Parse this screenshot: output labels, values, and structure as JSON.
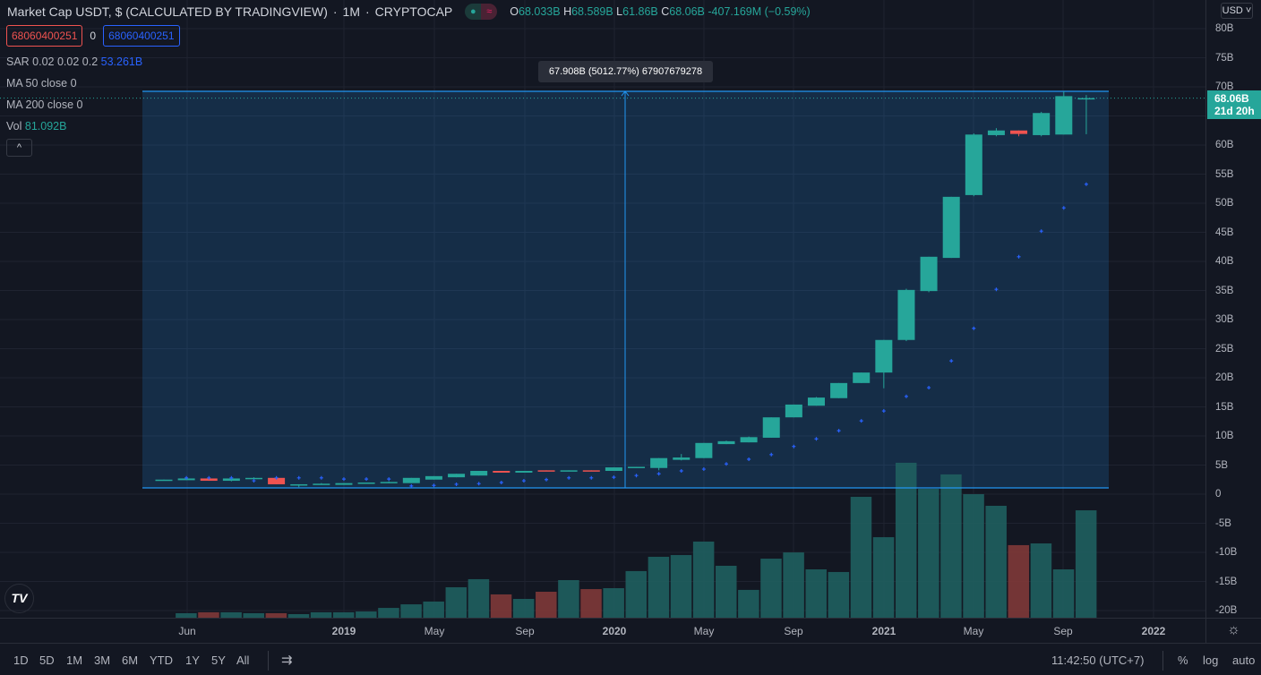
{
  "header": {
    "title": "Market Cap USDT, $ (CALCULATED BY TRADINGVIEW)",
    "interval": "1M",
    "exchange": "CRYPTOCAP",
    "ohlc": {
      "o_label": "O",
      "o": "68.033B",
      "h_label": "H",
      "h": "68.589B",
      "l_label": "L",
      "l": "61.86B",
      "c_label": "C",
      "c": "68.06B",
      "change": "-407.169M (−0.59%)"
    }
  },
  "order_boxes": {
    "sell": "68060400251",
    "qty": "0",
    "buy": "68060400251"
  },
  "indicators": {
    "sar": {
      "label": "SAR 0.02 0.02 0.2",
      "value": "53.261B"
    },
    "ma50": "MA 50 close 0",
    "ma200": "MA 200 close 0",
    "vol": {
      "label": "Vol",
      "value": "81.092B"
    }
  },
  "collapse_label": "^",
  "measure_tooltip": "67.908B (5012.77%) 67907679278",
  "price_axis": {
    "currency": "USD ˅",
    "current_price": "68.06B",
    "countdown": "21d 20h"
  },
  "colors": {
    "up": "#26a69a",
    "down": "#ef5350",
    "vol_up": "#1f5f5f",
    "vol_down": "#803838",
    "sar": "#2962ff",
    "measure": "#2196f3"
  },
  "time_axis": [
    "Jun",
    "2019",
    "May",
    "Sep",
    "2020",
    "May",
    "Sep",
    "2021",
    "May",
    "Sep",
    "2022"
  ],
  "toolbar": {
    "ranges": [
      "1D",
      "5D",
      "1M",
      "3M",
      "6M",
      "YTD",
      "1Y",
      "5Y",
      "All"
    ],
    "time": "11:42:50 (UTC+7)",
    "percent": "%",
    "log": "log",
    "auto": "auto"
  },
  "logo_text": "TV",
  "chart_data": {
    "type": "candlestick",
    "unit": "B USD",
    "start_month": "2018-05",
    "price_ticks": [
      80,
      75,
      70,
      65,
      60,
      55,
      50,
      45,
      40,
      35,
      30,
      25,
      20,
      15,
      10,
      5,
      0,
      -5,
      -10,
      -15,
      -20
    ],
    "ohlc": [
      [
        2.4,
        2.5,
        2.4,
        2.5
      ],
      [
        2.4,
        2.8,
        2.4,
        2.7
      ],
      [
        2.7,
        2.8,
        2.3,
        2.3
      ],
      [
        2.3,
        2.9,
        2.2,
        2.7
      ],
      [
        2.7,
        2.9,
        2.7,
        2.8
      ],
      [
        2.8,
        3.0,
        1.7,
        1.7
      ],
      [
        1.7,
        1.7,
        1.2,
        1.7
      ],
      [
        1.7,
        1.9,
        1.7,
        1.8
      ],
      [
        1.6,
        1.9,
        1.6,
        1.9
      ],
      [
        1.9,
        2.0,
        1.9,
        2.0
      ],
      [
        2.0,
        2.2,
        2.0,
        2.1
      ],
      [
        1.9,
        2.8,
        1.9,
        2.8
      ],
      [
        2.5,
        3.1,
        2.5,
        3.1
      ],
      [
        2.9,
        3.5,
        2.9,
        3.5
      ],
      [
        3.2,
        4.0,
        3.2,
        4.0
      ],
      [
        4.0,
        4.0,
        3.7,
        3.7
      ],
      [
        3.7,
        4.0,
        3.7,
        4.0
      ],
      [
        4.1,
        4.1,
        4.0,
        4.0
      ],
      [
        4.0,
        4.1,
        4.0,
        4.1
      ],
      [
        4.1,
        4.1,
        4.0,
        4.0
      ],
      [
        4.0,
        4.6,
        4.0,
        4.6
      ],
      [
        4.6,
        4.7,
        4.6,
        4.7
      ],
      [
        4.5,
        6.2,
        4.1,
        6.2
      ],
      [
        5.9,
        6.9,
        5.8,
        6.3
      ],
      [
        6.2,
        8.8,
        6.2,
        8.8
      ],
      [
        8.6,
        9.2,
        8.6,
        9.1
      ],
      [
        8.9,
        9.9,
        8.9,
        9.8
      ],
      [
        9.7,
        13.2,
        9.7,
        13.2
      ],
      [
        13.2,
        15.4,
        13.2,
        15.4
      ],
      [
        15.2,
        16.7,
        15.2,
        16.6
      ],
      [
        16.5,
        19.1,
        16.5,
        19.1
      ],
      [
        19.1,
        20.9,
        19.1,
        20.9
      ],
      [
        20.9,
        26.5,
        18.2,
        26.5
      ],
      [
        26.5,
        35.3,
        26.3,
        35.1
      ],
      [
        34.9,
        40.8,
        34.7,
        40.8
      ],
      [
        40.6,
        51.1,
        40.6,
        51.1
      ],
      [
        51.4,
        62.0,
        51.2,
        61.8
      ],
      [
        61.7,
        62.9,
        61.5,
        62.5
      ],
      [
        62.5,
        62.5,
        61.5,
        61.9
      ],
      [
        61.7,
        65.7,
        61.5,
        65.5
      ],
      [
        61.8,
        69.2,
        61.8,
        68.4
      ],
      [
        68.033,
        68.589,
        61.86,
        68.06
      ]
    ],
    "sar": [
      null,
      2.8,
      2.8,
      2.8,
      2.3,
      2.8,
      2.8,
      2.8,
      2.6,
      2.6,
      2.6,
      1.4,
      1.5,
      1.7,
      1.8,
      2.0,
      2.3,
      2.5,
      2.8,
      2.8,
      2.9,
      3.2,
      3.5,
      4.0,
      4.3,
      5.2,
      6.0,
      6.8,
      8.2,
      9.5,
      10.9,
      12.6,
      14.3,
      16.8,
      18.3,
      22.9,
      28.5,
      35.2,
      40.8,
      45.2,
      49.2,
      53.261
    ],
    "volume": [
      null,
      3.4,
      4.1,
      4.1,
      3.4,
      3.4,
      2.7,
      4.1,
      4.1,
      4.7,
      7.4,
      10.1,
      12.2,
      23.0,
      29.1,
      17.6,
      14.2,
      19.6,
      28.4,
      21.6,
      22.3,
      35.2,
      46.0,
      47.3,
      57.5,
      39.2,
      21.0,
      44.6,
      49.3,
      36.5,
      34.5,
      91.3,
      60.8,
      117.0,
      97.3,
      108.2,
      93.3,
      84.5,
      54.8,
      56.1,
      36.5,
      81.092
    ],
    "measure": {
      "from_price": 1.1,
      "to_price": 69.3,
      "delta_text": "67.908B (5012.77%)"
    }
  }
}
